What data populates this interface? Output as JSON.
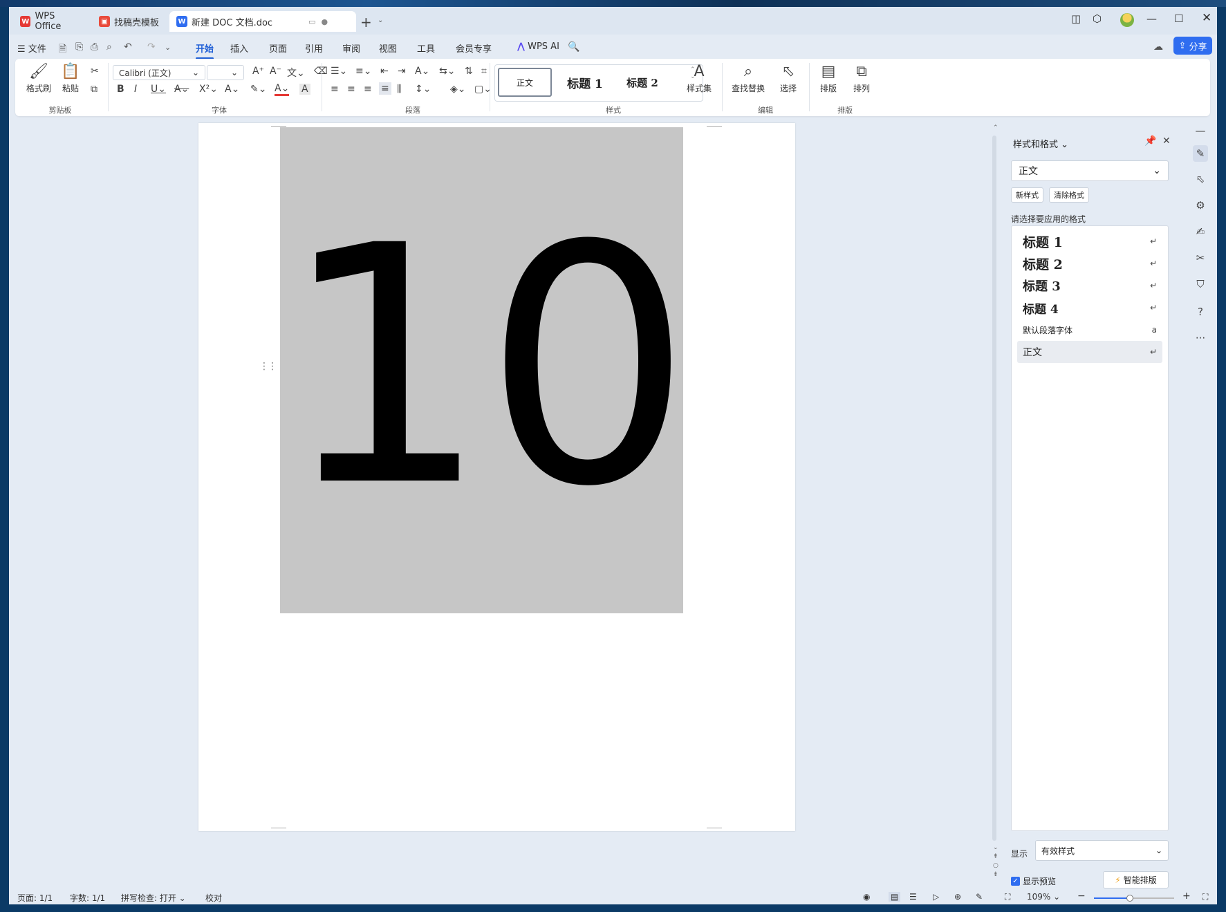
{
  "tabs": [
    {
      "label": "WPS Office",
      "logo": "W",
      "logo_color": "#e53935"
    },
    {
      "label": "找稿壳模板",
      "logo": "▣",
      "logo_color": "#e94b3c"
    },
    {
      "label": "新建 DOC 文档.doc",
      "logo": "W",
      "logo_color": "#2f6df0"
    }
  ],
  "menu": {
    "file": "文件",
    "items": [
      "开始",
      "插入",
      "页面",
      "引用",
      "审阅",
      "视图",
      "工具",
      "会员专享"
    ],
    "active": "开始",
    "wps_ai": "WPS AI",
    "share": "分享"
  },
  "ribbon": {
    "clipboard": {
      "format_painter": "格式刷",
      "paste": "粘贴",
      "label": "剪贴板"
    },
    "font": {
      "name": "Calibri (正文)",
      "size": "",
      "label": "字体"
    },
    "paragraph": {
      "label": "段落"
    },
    "styles": {
      "normal": "正文",
      "h1": "标题 1",
      "h2": "标题 2",
      "style_set": "样式集",
      "label": "样式"
    },
    "edit": {
      "find_replace": "查找替换",
      "select": "选择",
      "label": "编辑"
    },
    "layout": {
      "arrange_text": "排版",
      "arrange": "排列",
      "label": "排版"
    }
  },
  "document": {
    "content": "10",
    "image_bg": "#c6c6c6"
  },
  "style_panel": {
    "title": "样式和格式",
    "current_style": "正文",
    "new_style": "新样式",
    "clear_format": "清除格式",
    "prompt": "请选择要应用的格式",
    "styles": [
      {
        "label": "标题 1",
        "mark": "↵"
      },
      {
        "label": "标题 2",
        "mark": "↵"
      },
      {
        "label": "标题 3",
        "mark": "↵"
      },
      {
        "label": "标题 4",
        "mark": "↵"
      },
      {
        "label": "默认段落字体",
        "mark": "a"
      },
      {
        "label": "正文",
        "mark": "↵"
      }
    ],
    "show_label": "显示",
    "show_value": "有效样式",
    "show_preview": "显示预览",
    "smart_layout": "智能排版"
  },
  "status": {
    "page": "页面: 1/1",
    "words": "字数: 1/1",
    "spell": "拼写检查: 打开",
    "proof": "校对",
    "zoom": "109%",
    "zoom_level": 0.45
  },
  "colors": {
    "accent": "#2f6df0"
  }
}
